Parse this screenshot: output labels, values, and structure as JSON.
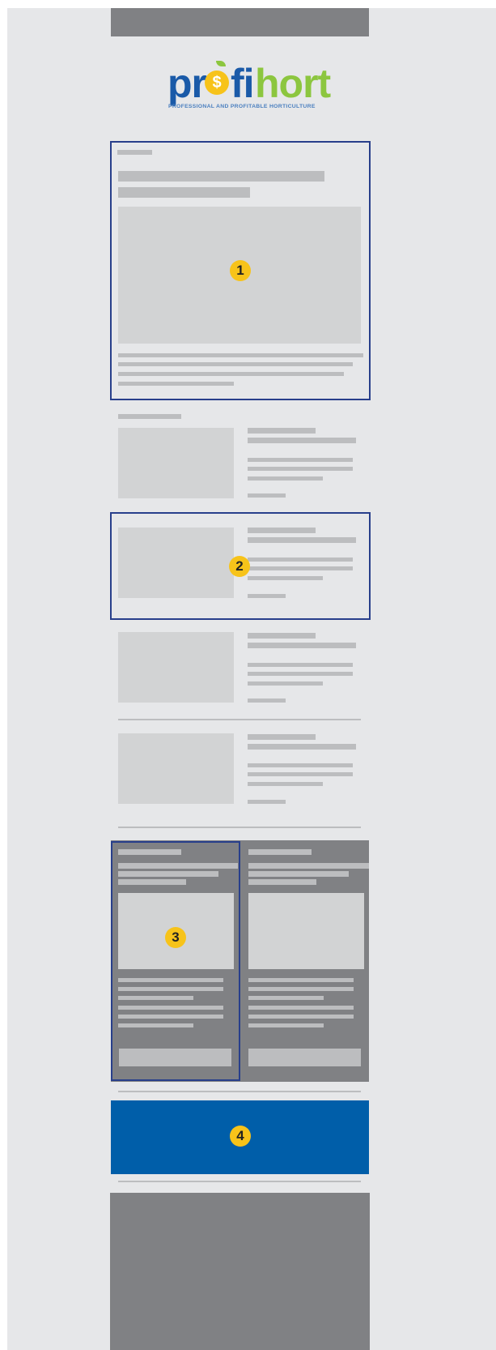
{
  "logo": {
    "part_pr": "pr",
    "part_fi": "fi",
    "part_hort": "hort",
    "dollar": "$",
    "tagline": "PROFESSIONAL AND PROFITABLE HORTICULTURE",
    "colors": {
      "blue": "#1a5aa8",
      "green": "#8cc63f",
      "yellow": "#f7c31a"
    }
  },
  "markers": {
    "m1": "1",
    "m2": "2",
    "m3": "3",
    "m4": "4"
  },
  "colors": {
    "page_bg": "#e6e7e9",
    "dark_block": "#808184",
    "placeholder": "#bcbdbf",
    "image_placeholder": "#d2d3d4",
    "highlight_border": "#283f8b",
    "marker": "#f7c31a",
    "banner": "#005ea9"
  }
}
